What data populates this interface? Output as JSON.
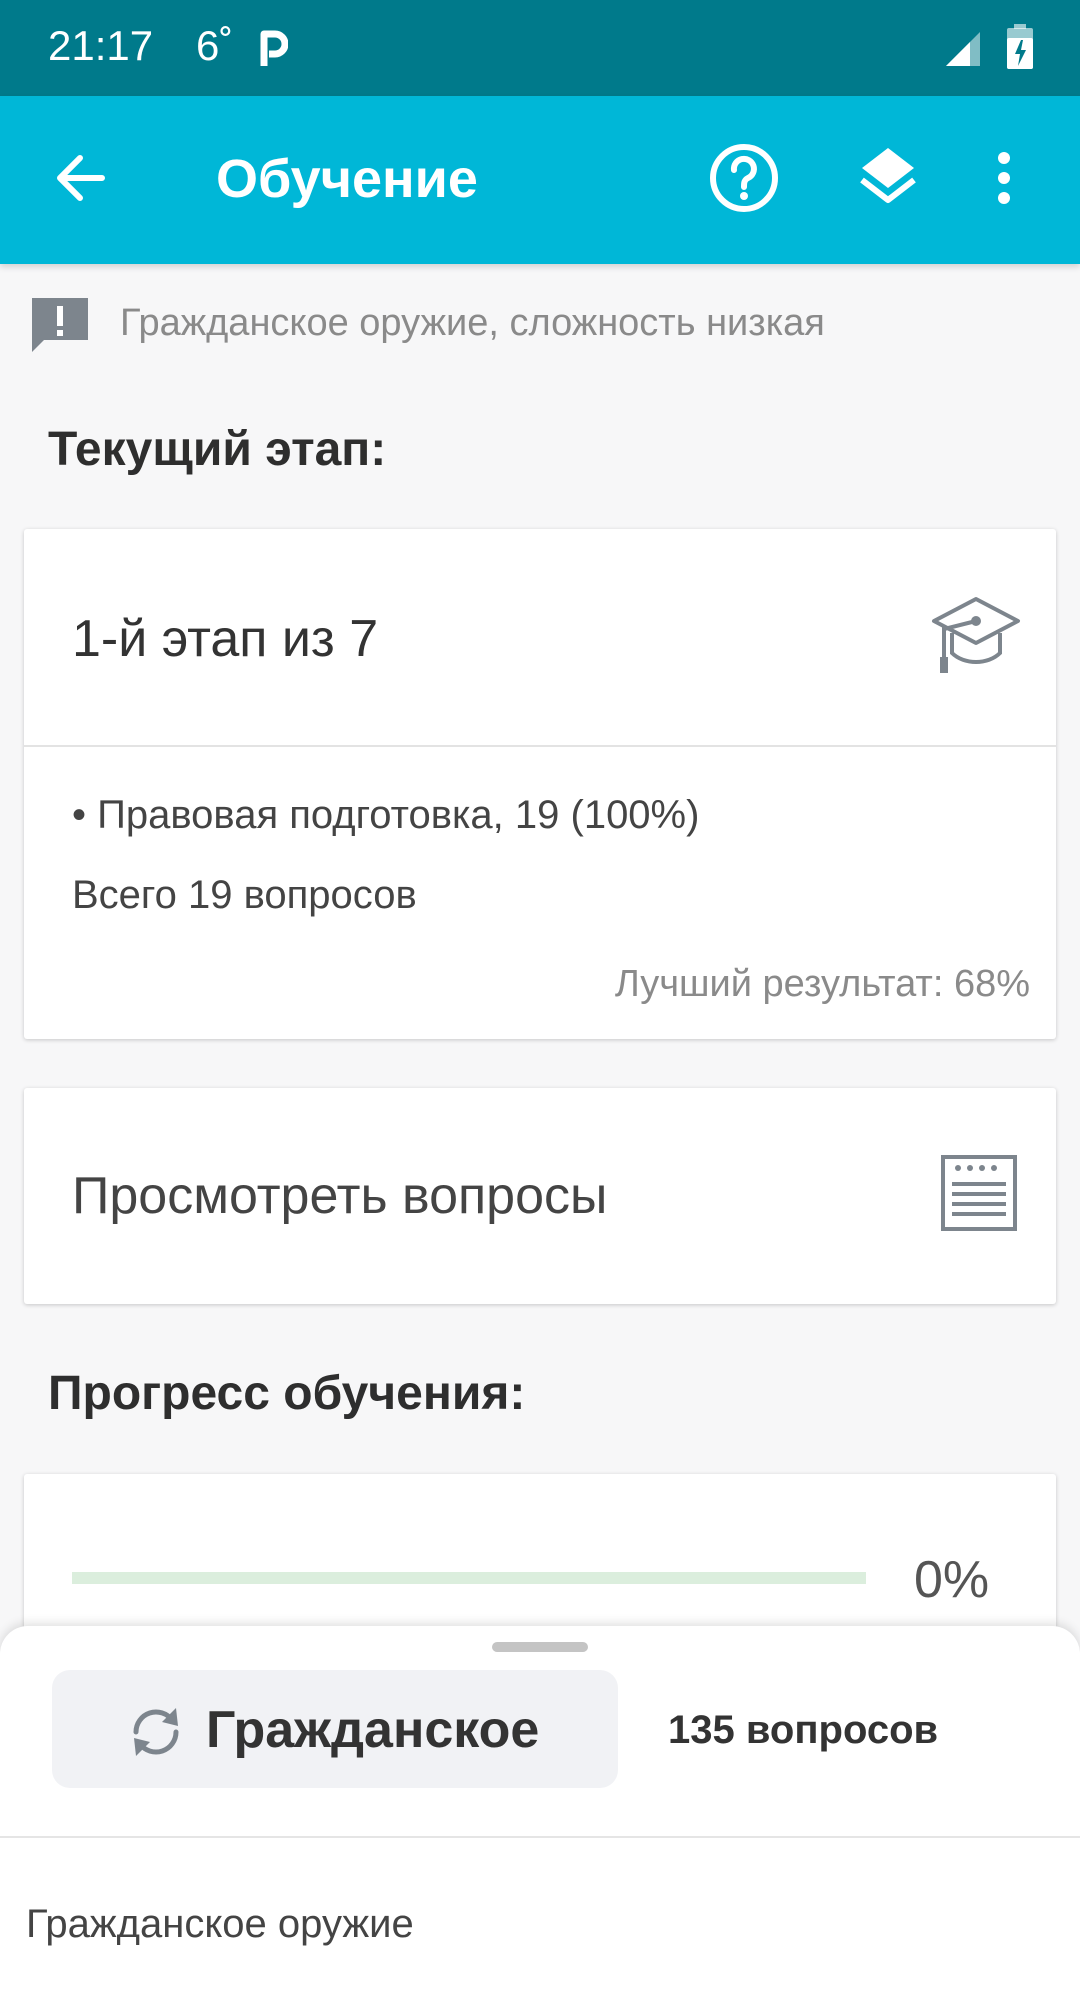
{
  "status_bar": {
    "time": "21:17",
    "temperature": "6˚",
    "icons": [
      "p-app-icon",
      "signal-icon",
      "battery-icon"
    ]
  },
  "app_bar": {
    "title": "Обучение",
    "icons": [
      "back-arrow-icon",
      "help-icon",
      "layers-icon",
      "more-vert-icon"
    ]
  },
  "info": {
    "text": "Гражданское оружие, сложность низкая",
    "icon": "feedback-exclamation-icon"
  },
  "current_stage": {
    "heading": "Текущий этап:",
    "stage_label": "1-й этап из 7",
    "topic": "• Правовая подготовка, 19 (100%)",
    "total": "Всего 19 вопросов",
    "best_result": "Лучший результат: 68%",
    "icon": "graduation-cap-icon"
  },
  "view_questions": {
    "label": "Просмотреть вопросы",
    "icon": "list-document-icon"
  },
  "progress": {
    "heading": "Прогресс обучения:",
    "value": 0,
    "percent_text": "0%"
  },
  "bottom_sheet": {
    "category_button": "Гражданское",
    "question_count": "135 вопросов",
    "item": "Гражданское оружие",
    "icon": "swap-refresh-icon"
  },
  "colors": {
    "status_bar": "#007a8b",
    "app_bar": "#00b7d7",
    "progress_track": "#dbeedd"
  }
}
